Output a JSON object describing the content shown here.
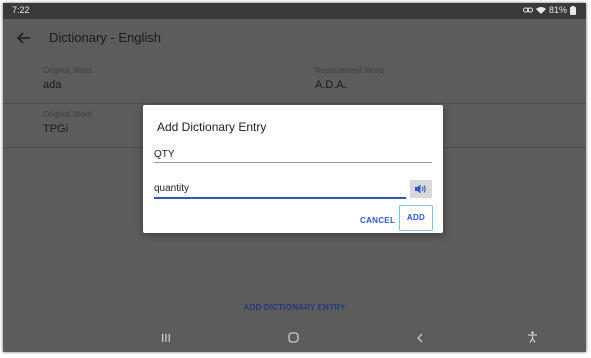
{
  "status": {
    "time": "7:22",
    "battery": "81%"
  },
  "app": {
    "title": "Dictionary - English"
  },
  "entries": [
    {
      "original_label": "Original Word",
      "original": "ada",
      "replacement_label": "Replacement Word",
      "replacement": "A.D.A."
    },
    {
      "original_label": "Original Word",
      "original": "TPGi"
    }
  ],
  "dialog": {
    "title": "Add Dictionary Entry",
    "original_value": "QTY",
    "replacement_value": "quantity",
    "cancel_label": "CANCEL",
    "add_label": "ADD"
  },
  "bottom": {
    "add_entry_label": "ADD DICTIONARY ENTRY"
  },
  "icons": {
    "back": "arrow-left-icon",
    "speak": "speaker-icon",
    "recents": "recents-icon",
    "home": "home-icon",
    "nav_back": "chevron-left-icon",
    "accessibility": "accessibility-icon"
  },
  "colors": {
    "accent": "#2f56c8",
    "scrim": "#5c5c5c"
  }
}
